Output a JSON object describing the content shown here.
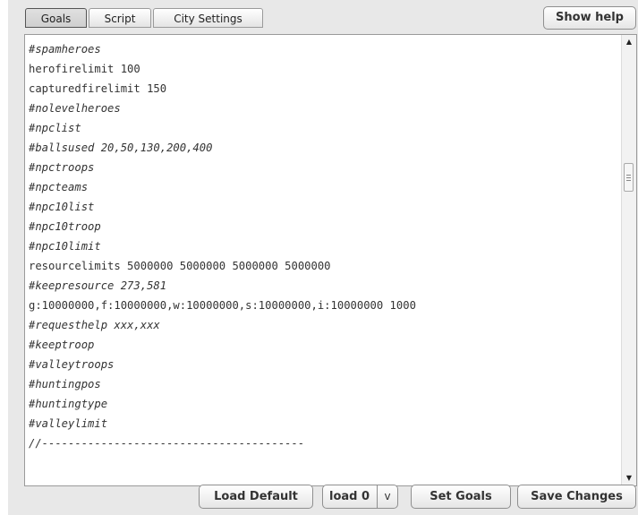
{
  "tabs": [
    {
      "label": "Goals",
      "active": true
    },
    {
      "label": "Script",
      "active": false
    },
    {
      "label": "City Settings",
      "active": false
    }
  ],
  "header": {
    "show_help_label": "Show help"
  },
  "editor": {
    "lines": [
      "#spamheroes",
      "herofirelimit 100",
      "capturedfirelimit 150",
      "#nolevelheroes",
      "#npclist",
      "#ballsused 20,50,130,200,400",
      "#npctroops",
      "#npcteams",
      "#npc10list",
      "#npc10troop",
      "#npc10limit",
      "resourcelimits 5000000 5000000 5000000 5000000",
      "#keepresource 273,581",
      "g:10000000,f:10000000,w:10000000,s:10000000,i:10000000 1000",
      "#requesthelp xxx,xxx",
      "#keeptroop",
      "#valleytroops",
      "#huntingpos",
      "#huntingtype",
      "#valleylimit",
      "//----------------------------------------"
    ],
    "scroll": {
      "up_icon": "▲",
      "down_icon": "▼",
      "thumb_position": 0.3
    }
  },
  "footer": {
    "load_default_label": "Load Default",
    "load_select_value": "load 0",
    "dropdown_icon": "v",
    "set_goals_label": "Set Goals",
    "save_changes_label": "Save Changes"
  }
}
